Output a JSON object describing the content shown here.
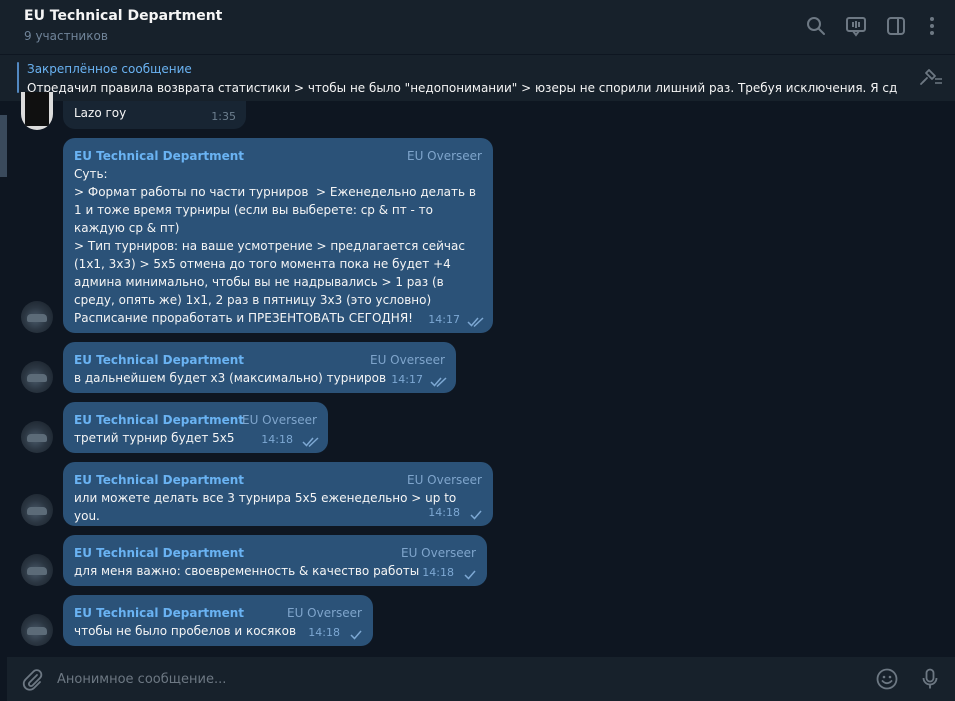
{
  "header": {
    "title": "EU Technical Department",
    "subtitle": "9 участников",
    "icons": [
      "search-icon",
      "video-chat-icon",
      "sidebar-toggle-icon",
      "more-icon"
    ]
  },
  "pinned": {
    "title": "Закреплённое сообщение",
    "text": "Отредачил правила возврата статистики > чтобы не было \"недопонимании\" > юзеры не спорили лишний раз. Требуя исключения. Я сдел..."
  },
  "messages": [
    {
      "text": "Lazo гоу",
      "time": "1:35"
    },
    {
      "sender": "EU Technical Department",
      "role": "EU Overseer",
      "text": "Суть:\n> Формат работы по части турниров  > Еженедельно делать в 1 и тоже время турниры (если вы выберете: ср & пт - то каждую ср & пт)\n> Тип турниров: на ваше усмотрение > предлагается сейчас (1x1, 3x3) > 5x5 отмена до того момента пока не будет +4 админа минимально, чтобы вы не надрывались > 1 раз (в среду, опять же) 1x1, 2 раз в пятницу 3x3 (это условно)\nРасписание проработать и ПРЕЗЕНТОВАТЬ СЕГОДНЯ!",
      "time": "14:17",
      "status": "read"
    },
    {
      "sender": "EU Technical Department",
      "role": "EU Overseer",
      "text": "в дальнейшем будет x3 (максимально) турниров",
      "time": "14:17",
      "status": "read"
    },
    {
      "sender": "EU Technical Department",
      "role": "EU Overseer",
      "text": "третий турнир будет 5x5",
      "time": "14:18",
      "status": "read"
    },
    {
      "sender": "EU Technical Department",
      "role": "EU Overseer",
      "text": "или можете делать все 3 турнира 5x5 еженедельно > up to you.",
      "time": "14:18",
      "status": "sent"
    },
    {
      "sender": "EU Technical Department",
      "role": "EU Overseer",
      "text": "для меня важно: своевременность & качество работы",
      "time": "14:18",
      "status": "sent"
    },
    {
      "sender": "EU Technical Department",
      "role": "EU Overseer",
      "text": "чтобы не было пробелов и косяков",
      "time": "14:18",
      "status": "sent"
    }
  ],
  "composer": {
    "placeholder": "Анонимное сообщение...",
    "icons": [
      "attach-icon",
      "emoji-icon",
      "microphone-icon"
    ]
  },
  "colors": {
    "background": "#0e1621",
    "panel": "#17212b",
    "bubble": "#2b5278",
    "accent": "#6ab3f3"
  }
}
